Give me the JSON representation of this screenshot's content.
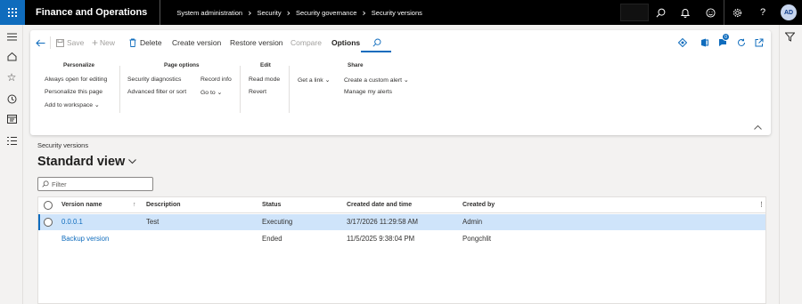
{
  "app": {
    "name": "Finance and Operations"
  },
  "breadcrumbs": [
    "System administration",
    "Security",
    "Security governance",
    "Security versions"
  ],
  "user": {
    "initials": "AD"
  },
  "toolbar": {
    "save": "Save",
    "new": "New",
    "delete": "Delete",
    "create_version": "Create version",
    "restore_version": "Restore version",
    "compare": "Compare",
    "options": "Options",
    "notification_count": "0"
  },
  "ribbon": {
    "personalize": {
      "header": "Personalize",
      "items": [
        "Always open for editing",
        "Personalize this page",
        "Add to workspace"
      ]
    },
    "page_options": {
      "header": "Page options",
      "items": [
        "Security diagnostics",
        "Advanced filter or sort",
        "Record info",
        "Go to"
      ]
    },
    "edit": {
      "header": "Edit",
      "items": [
        "Read mode",
        "Revert"
      ]
    },
    "share": {
      "header": "Share",
      "items": [
        "Get a link",
        "Create a custom alert",
        "Manage my alerts"
      ]
    }
  },
  "page": {
    "caption": "Security versions",
    "view_title": "Standard view",
    "filter_placeholder": "Filter"
  },
  "grid": {
    "columns": [
      "Version name",
      "Description",
      "Status",
      "Created date and time",
      "Created by"
    ],
    "rows": [
      {
        "version": "0.0.0.1",
        "description": "Test",
        "status": "Executing",
        "created": "3/17/2026 11:29:58 AM",
        "by": "Admin",
        "selected": true
      },
      {
        "version": "Backup version",
        "description": "",
        "status": "Ended",
        "created": "11/5/2025 9:38:04 PM",
        "by": "Pongchlit",
        "selected": false
      }
    ]
  },
  "colors": {
    "accent": "#0f6cbd",
    "topbar": "#000000",
    "selected_row": "#cfe4fa"
  }
}
